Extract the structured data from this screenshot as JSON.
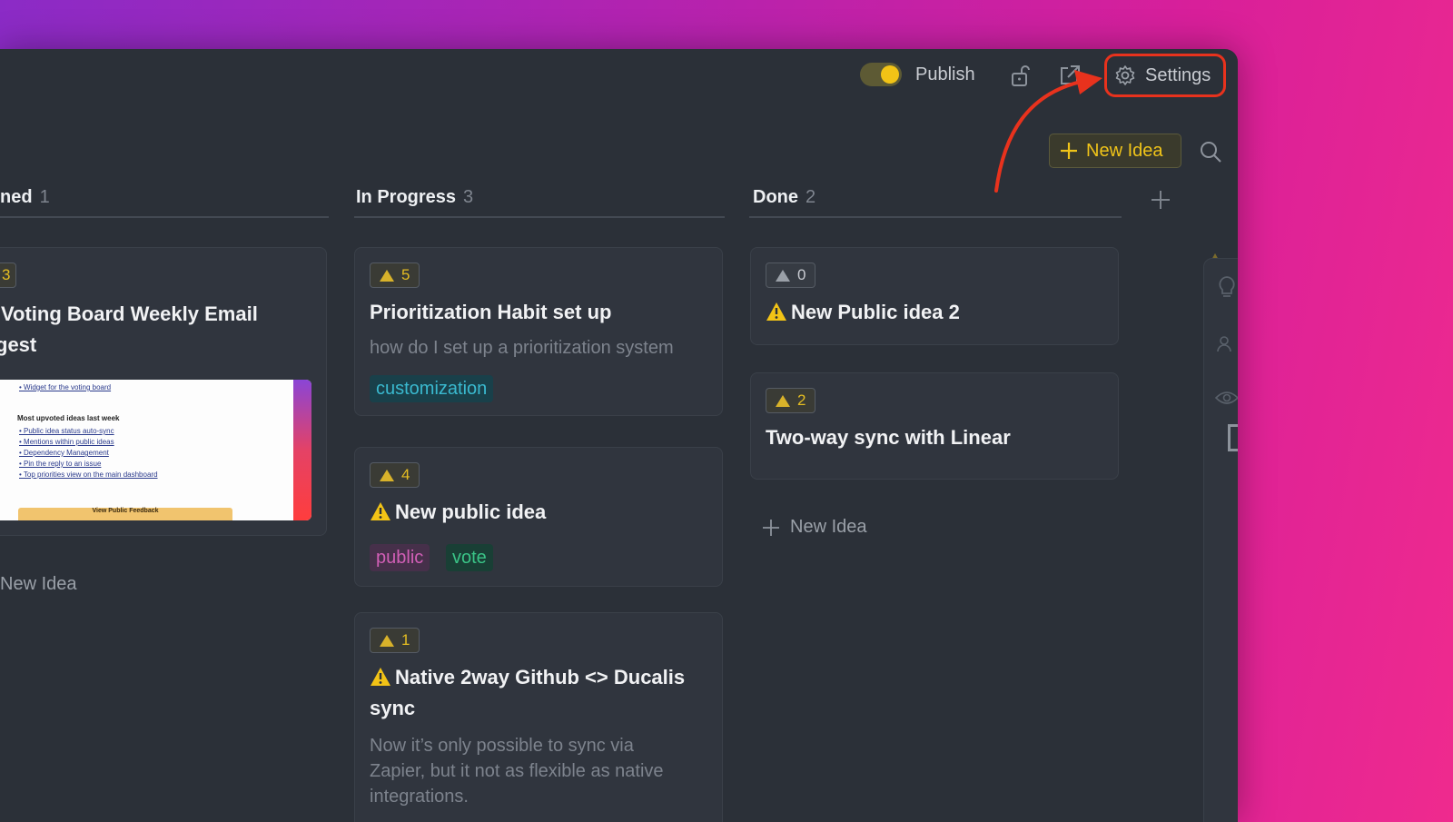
{
  "topbar": {
    "publish_label": "Publish",
    "settings_label": "Settings",
    "toggle_on": true
  },
  "toolbar": {
    "new_idea_label": "New Idea"
  },
  "columns": [
    {
      "title": "ned",
      "count": "1",
      "cards": [
        {
          "votes": "3",
          "title": "Voting Board Weekly Email",
          "title_line2": "gest",
          "thumbnail": {
            "lines_top": [
              "• Widget for the voting board"
            ],
            "heading": "Most upvoted ideas last week",
            "lines": [
              "• Public idea status auto-sync",
              "• Mentions within public ideas",
              "• Dependency Management",
              "• Pin the reply to an issue",
              "• Top priorities view on the main dashboard"
            ],
            "cta": "View Public Feedback"
          }
        }
      ],
      "add_label": "New Idea"
    },
    {
      "title": "In Progress",
      "count": "3",
      "cards": [
        {
          "votes": "5",
          "title": "Prioritization Habit set up",
          "desc": "how do I set up a prioritization system",
          "tags": [
            "customization"
          ]
        },
        {
          "votes": "4",
          "title": "New public idea",
          "warning": true,
          "tags": [
            "public",
            "vote"
          ]
        },
        {
          "votes": "1",
          "title": "Native 2way Github <> Ducalis",
          "title_line2": "sync",
          "warning": true,
          "desc_lines": [
            "Now it’s only possible to sync via",
            "Zapier, but it not as flexible as native",
            "integrations."
          ]
        }
      ]
    },
    {
      "title": "Done",
      "count": "2",
      "cards": [
        {
          "votes": "0",
          "title": "New Public idea 2",
          "warning": true
        },
        {
          "votes": "2",
          "title": "Two-way sync with Linear"
        }
      ],
      "add_label": "New Idea"
    }
  ],
  "colors": {
    "accent": "#f0c419",
    "highlight": "#e8321d",
    "window_bg": "#2b3038",
    "card_bg": "#30353e"
  },
  "icons": [
    "lock-open-icon",
    "external-link-icon",
    "gear-icon",
    "plus-icon",
    "search-icon",
    "warning-icon",
    "lightbulb-icon",
    "users-icon",
    "eye-icon"
  ]
}
